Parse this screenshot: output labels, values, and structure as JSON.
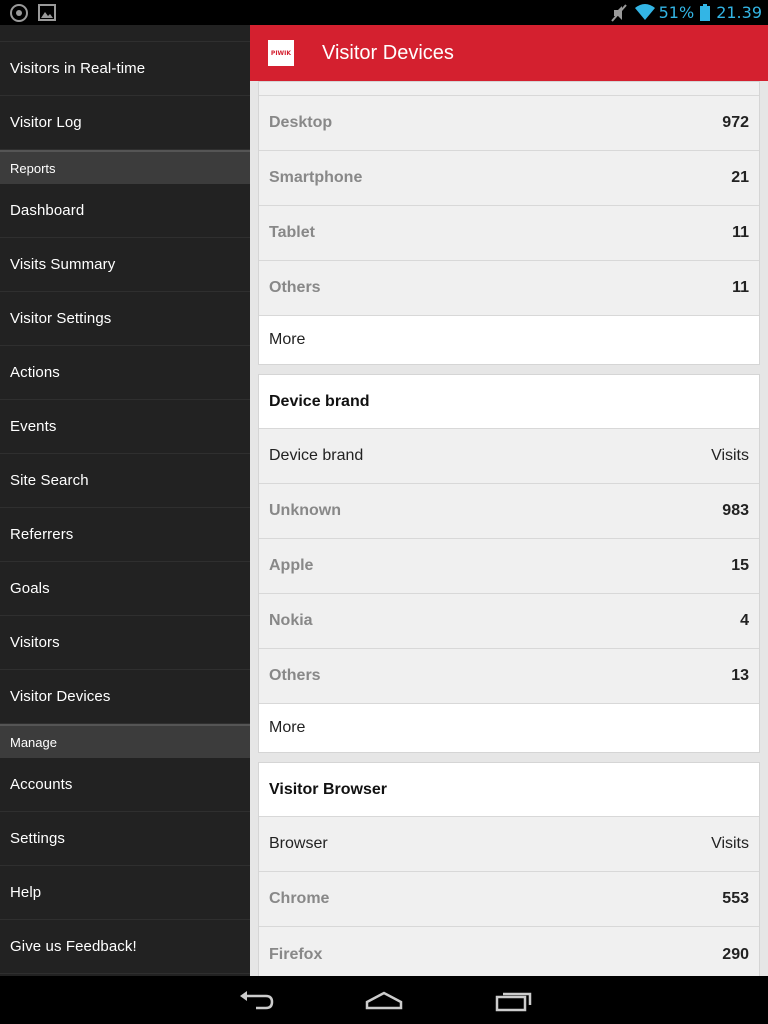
{
  "status": {
    "battery": "51%",
    "time": "21.39"
  },
  "sidebar": {
    "items_top": [
      {
        "label": "Visitors in Real-time"
      },
      {
        "label": "Visitor Log"
      }
    ],
    "reports_header": "Reports",
    "reports": [
      {
        "label": "Dashboard"
      },
      {
        "label": "Visits Summary"
      },
      {
        "label": "Visitor Settings"
      },
      {
        "label": "Actions"
      },
      {
        "label": "Events"
      },
      {
        "label": "Site Search"
      },
      {
        "label": "Referrers"
      },
      {
        "label": "Goals"
      },
      {
        "label": "Visitors"
      },
      {
        "label": "Visitor Devices"
      }
    ],
    "manage_header": "Manage",
    "manage": [
      {
        "label": "Accounts"
      },
      {
        "label": "Settings"
      },
      {
        "label": "Help"
      },
      {
        "label": "Give us Feedback!"
      }
    ]
  },
  "header": {
    "logo_text": "PIWIK",
    "title": "Visitor Devices"
  },
  "device_type": {
    "rows": [
      {
        "label": "Desktop",
        "value": "972"
      },
      {
        "label": "Smartphone",
        "value": "21"
      },
      {
        "label": "Tablet",
        "value": "11"
      },
      {
        "label": "Others",
        "value": "11"
      }
    ],
    "more": "More"
  },
  "device_brand": {
    "title": "Device brand",
    "col_label": "Device brand",
    "col_value": "Visits",
    "rows": [
      {
        "label": "Unknown",
        "value": "983"
      },
      {
        "label": "Apple",
        "value": "15"
      },
      {
        "label": "Nokia",
        "value": "4"
      },
      {
        "label": "Others",
        "value": "13"
      }
    ],
    "more": "More"
  },
  "visitor_browser": {
    "title": "Visitor Browser",
    "col_label": "Browser",
    "col_value": "Visits",
    "rows": [
      {
        "label": "Chrome",
        "value": "553"
      },
      {
        "label": "Firefox",
        "value": "290"
      }
    ]
  }
}
